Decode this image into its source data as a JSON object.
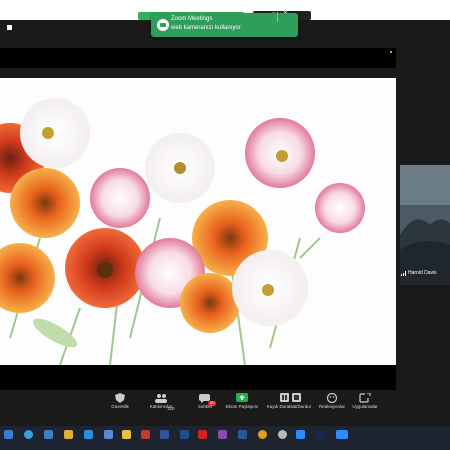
{
  "toast": {
    "title": "Zoom Meetings",
    "subtitle": "web kameranızı kullanıyor",
    "chevron": "⌄"
  },
  "topbar": {
    "view_label": "Görünüm"
  },
  "participant": {
    "name": "Harold Davis"
  },
  "controls": {
    "items": [
      {
        "label": "Güvenlik",
        "icon": "shield-icon"
      },
      {
        "label": "Katılımcılar",
        "icon": "people-icon",
        "count": "120"
      },
      {
        "label": "Sohbet",
        "icon": "chat-icon",
        "badge": "80"
      },
      {
        "label": "Ekran Paylaşımı",
        "icon": "share-screen-icon"
      },
      {
        "label": "Kaydı Duraklat/Durdur",
        "icon": "pause-record-icon"
      },
      {
        "label": "Reaksiyonlar",
        "icon": "reactions-icon"
      },
      {
        "label": "Uygulamalar",
        "icon": "apps-icon"
      }
    ]
  },
  "colors": {
    "accent_green": "#2e9e5a",
    "share_green": "#23b14d",
    "badge_red": "#e22222",
    "taskbar": "#1d2430"
  }
}
